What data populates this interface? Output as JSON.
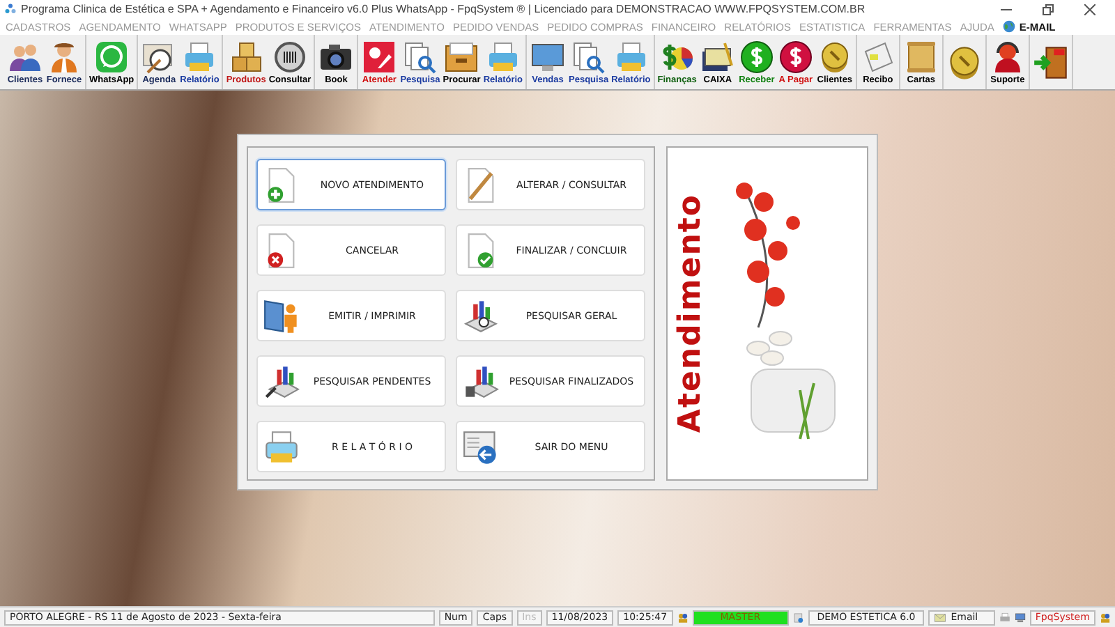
{
  "window": {
    "title": "Programa Clinica de Estética e SPA + Agendamento e Financeiro v6.0 Plus WhatsApp - FpqSystem ® | Licenciado para  DEMONSTRACAO WWW.FPQSYSTEM.COM.BR"
  },
  "menu_bar": {
    "items": [
      "CADASTROS",
      "AGENDAMENTO",
      "WHATSAPP",
      "PRODUTOS E SERVIÇOS",
      "ATENDIMENTO",
      "PEDIDO VENDAS",
      "PEDIDO COMPRAS",
      "FINANCEIRO",
      "RELATÓRIOS",
      "ESTATISTICA",
      "FERRAMENTAS",
      "AJUDA"
    ],
    "email": "E-MAIL"
  },
  "toolbar": {
    "groups": [
      [
        {
          "label": "Clientes",
          "color": "#1a2a5a"
        },
        {
          "label": "Fornece",
          "color": "#1a2a5a"
        }
      ],
      [
        {
          "label": "WhatsApp",
          "color": "#000000"
        }
      ],
      [
        {
          "label": "Agenda",
          "color": "#1a2a5a"
        },
        {
          "label": "Relatório",
          "color": "#1a3aa0"
        }
      ],
      [
        {
          "label": "Produtos",
          "color": "#c01818"
        },
        {
          "label": "Consultar",
          "color": "#000000"
        }
      ],
      [
        {
          "label": "Book",
          "color": "#000000"
        }
      ],
      [
        {
          "label": "Atender",
          "color": "#d01010"
        },
        {
          "label": "Pesquisa",
          "color": "#1a3aa0"
        },
        {
          "label": "Procurar",
          "color": "#000000"
        },
        {
          "label": "Relatório",
          "color": "#1a3aa0"
        }
      ],
      [
        {
          "label": "Vendas",
          "color": "#1a3aa0"
        },
        {
          "label": "Pesquisa",
          "color": "#1a3aa0"
        },
        {
          "label": "Relatório",
          "color": "#1a3aa0"
        }
      ],
      [
        {
          "label": "Finanças",
          "color": "#106010"
        },
        {
          "label": "CAIXA",
          "color": "#000000"
        },
        {
          "label": "Receber",
          "color": "#108010"
        },
        {
          "label": "A Pagar",
          "color": "#d01010"
        },
        {
          "label": "Clientes",
          "color": "#000000"
        }
      ],
      [
        {
          "label": "Recibo",
          "color": "#000000"
        }
      ],
      [
        {
          "label": "Cartas",
          "color": "#000000"
        }
      ],
      [
        {
          "kind": "icon_only"
        }
      ],
      [
        {
          "label": "Suporte",
          "color": "#000000"
        }
      ],
      [
        {
          "kind": "icon_only"
        }
      ]
    ]
  },
  "main_menu": {
    "title": "Atendimento",
    "buttons": [
      {
        "label": "NOVO ATENDIMENTO",
        "selected": true
      },
      {
        "label": "ALTERAR  /  CONSULTAR",
        "selected": false
      },
      {
        "label": "CANCELAR",
        "selected": false
      },
      {
        "label": "FINALIZAR  /  CONCLUIR",
        "selected": false
      },
      {
        "label": "EMITIR  /  IMPRIMIR",
        "selected": false
      },
      {
        "label": "PESQUISAR GERAL",
        "selected": false
      },
      {
        "label": "PESQUISAR PENDENTES",
        "selected": false
      },
      {
        "label": "PESQUISAR FINALIZADOS",
        "selected": false
      },
      {
        "label": "R E L A T Ó R I O",
        "selected": false
      },
      {
        "label": "SAIR DO MENU",
        "selected": false
      }
    ]
  },
  "status_bar": {
    "location": "PORTO ALEGRE - RS 11 de Agosto de 2023 - Sexta-feira",
    "indicators": [
      {
        "label": "Num",
        "disabled": false
      },
      {
        "label": "Caps",
        "disabled": false
      },
      {
        "label": "Ins",
        "disabled": true
      }
    ],
    "date": "11/08/2023",
    "time": "10:25:47",
    "user": "MASTER",
    "database": "DEMO ESTETICA 6.0",
    "email": "Email",
    "brand": "FpqSystem"
  }
}
